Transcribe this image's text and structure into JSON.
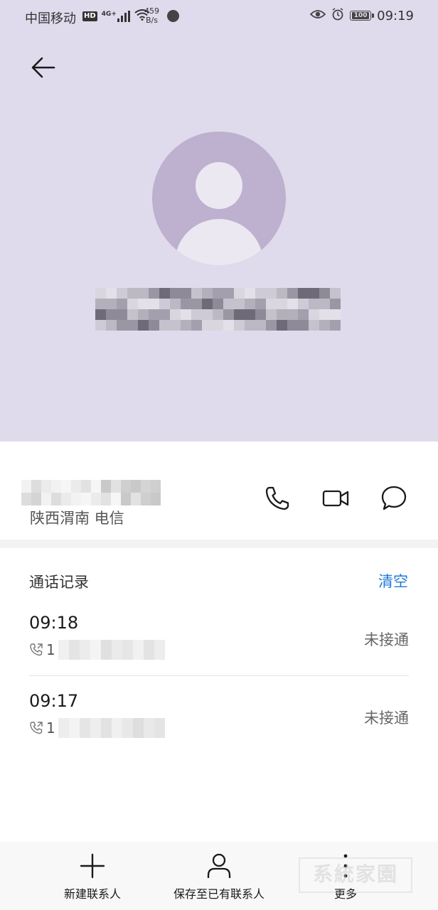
{
  "status_bar": {
    "carrier": "中国移动",
    "hd_badge": "HD",
    "network": "4G+",
    "speed_value": "459",
    "speed_unit": "B/s",
    "battery": "100",
    "time": "09:19"
  },
  "contact": {
    "location": "陕西渭南 电信"
  },
  "call_log": {
    "title": "通话记录",
    "clear_label": "清空",
    "entries": [
      {
        "time": "09:18",
        "number_prefix": "1",
        "status": "未接通"
      },
      {
        "time": "09:17",
        "number_prefix": "1",
        "status": "未接通"
      }
    ]
  },
  "bottom_bar": {
    "new_contact_label": "新建联系人",
    "save_existing_label": "保存至已有联系人",
    "more_label": "更多"
  },
  "colors": {
    "header_bg": "#e0dbec",
    "avatar_bg": "#bdb1cf",
    "accent": "#1e78d8"
  }
}
